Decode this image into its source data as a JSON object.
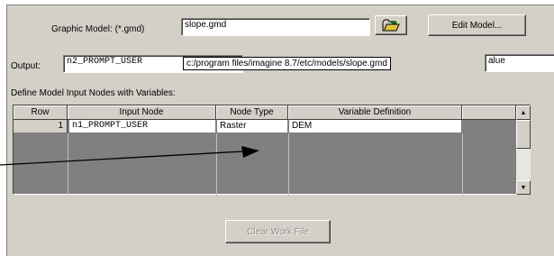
{
  "graphic_model": {
    "label": "Graphic Model: (*.gmd)",
    "value": "slope.gmd",
    "edit_button": "Edit Model..."
  },
  "output": {
    "label": "Output:",
    "value": "n2_PROMPT_USER",
    "tooltip": "c:/program files/imagine 8.7/etc/models/slope.gmd",
    "trailing_value": "alue"
  },
  "define_label": "Define Model Input Nodes with Variables:",
  "table": {
    "headers": {
      "row": "Row",
      "input_node": "Input Node",
      "node_type": "Node Type",
      "variable_definition": "Variable Definition"
    },
    "rows": [
      {
        "row": "1",
        "input_node": "n1_PROMPT_USER",
        "node_type": "Raster",
        "variable_definition": "DEM"
      }
    ]
  },
  "clear_button": "Clear Work File",
  "icons": {
    "browse": "folder-open-icon",
    "scroll_up": "up-arrow-icon",
    "scroll_down": "down-arrow-icon"
  },
  "colors": {
    "dialog_bg": "#d4d0c8",
    "grid_bg": "#808080",
    "folder_yellow": "#e0c040"
  }
}
